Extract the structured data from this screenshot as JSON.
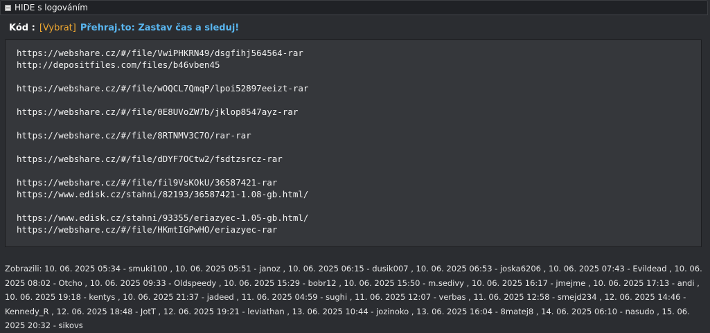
{
  "hide": {
    "title": "HIDE s logováním"
  },
  "code": {
    "label": "Kód :",
    "select_label": "[Vybrat]",
    "promo_label": "Přehraj.to: Zastav čas a sleduj!",
    "lines": [
      "https://webshare.cz/#/file/VwiPHKRN49/dsgfihj564564-rar",
      "http://depositfiles.com/files/b46vben45",
      "",
      "https://webshare.cz/#/file/wOQCL7QmqP/lpoi52897eeizt-rar",
      "",
      "https://webshare.cz/#/file/0E8UVoZW7b/jklop8547ayz-rar",
      "",
      "https://webshare.cz/#/file/8RTNMV3C7O/rar-rar",
      "",
      "https://webshare.cz/#/file/dDYF7OCtw2/fsdtzsrcz-rar",
      "",
      "https://webshare.cz/#/file/fil9VsKOkU/36587421-rar",
      "https://www.edisk.cz/stahni/82193/36587421-1.08-gb.html/",
      "",
      "https://www.edisk.cz/stahni/93355/eriazyec-1.05-gb.html/",
      "https://webshare.cz/#/file/HKmtIGPwHO/eriazyec-rar"
    ]
  },
  "viewers": {
    "text": "Zobrazili: 10. 06. 2025 05:34 - smuki100 , 10. 06. 2025 05:51 - janoz , 10. 06. 2025 06:15 - dusik007 , 10. 06. 2025 06:53 - joska6206 , 10. 06. 2025 07:43 - Evildead , 10. 06. 2025 08:02 - Otcho , 10. 06. 2025 09:33 - Oldspeedy , 10. 06. 2025 15:29 - bobr12 , 10. 06. 2025 15:50 - m.sedivy , 10. 06. 2025 16:17 - jmejme , 10. 06. 2025 17:13 - andi , 10. 06. 2025 19:18 - kentys , 10. 06. 2025 21:37 - jadeed , 11. 06. 2025 04:59 - sughi , 11. 06. 2025 12:07 - verbas , 11. 06. 2025 12:58 - smejd234 , 12. 06. 2025 14:46 - Kennedy_R , 12. 06. 2025 18:48 - JotT , 12. 06. 2025 19:21 - leviathan , 13. 06. 2025 10:44 - jozinoko , 13. 06. 2025 16:04 - 8matej8 , 14. 06. 2025 06:10 - nasudo , 15. 06. 2025 20:32 - sikovs"
  }
}
